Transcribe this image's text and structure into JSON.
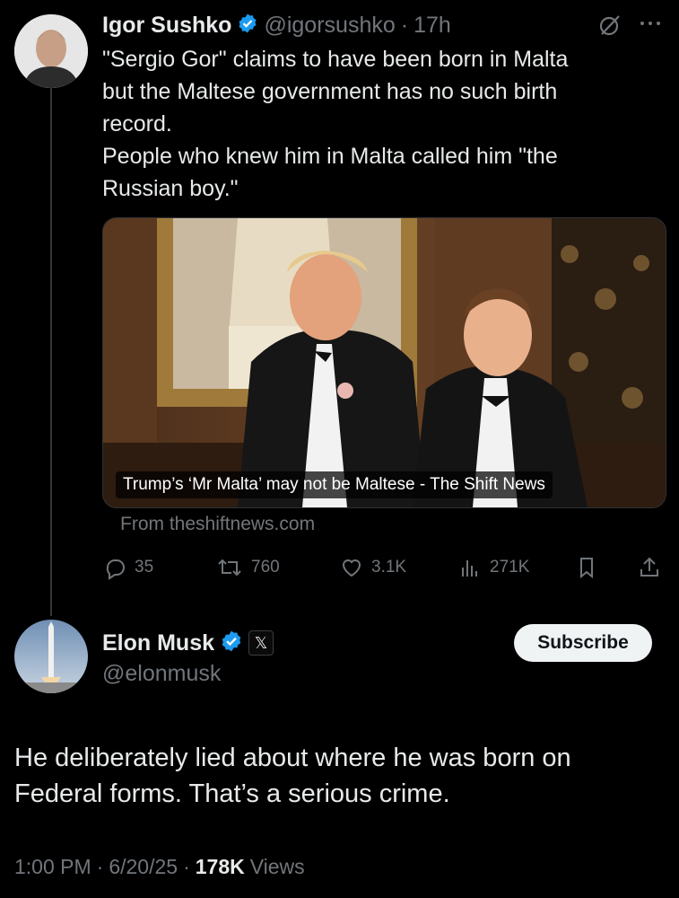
{
  "original": {
    "name": "Igor Sushko",
    "handle": "@igorsushko",
    "separator": "·",
    "time": "17h",
    "text_lines": [
      "\"Sergio Gor\" claims to have been born in Malta",
      "but the Maltese government has no such birth",
      "record.",
      "People who knew him in Malta called him \"the",
      "Russian boy.\""
    ],
    "card": {
      "caption": "Trump’s ‘Mr Malta’ may not be Maltese - The Shift News",
      "source": "From theshiftnews.com"
    },
    "actions": {
      "replies": "35",
      "reposts": "760",
      "likes": "3.1K",
      "views": "271K"
    }
  },
  "reply": {
    "name": "Elon Musk",
    "handle": "@elonmusk",
    "subscribe_label": "Subscribe",
    "text_lines": [
      "He deliberately lied about where he was born on",
      "Federal forms. That’s a serious crime."
    ],
    "meta": {
      "time": "1:00 PM",
      "sep1": "·",
      "date": "6/20/25",
      "sep2": "·",
      "views_count": "178K",
      "views_label": "Views"
    }
  },
  "colors": {
    "background": "#000000",
    "text": "#e7e9ea",
    "muted": "#71767b",
    "verified": "#1d9bf0",
    "button_bg": "#eff3f4"
  },
  "icons": [
    "grok-icon",
    "more-icon",
    "reply-icon",
    "repost-icon",
    "like-icon",
    "views-icon",
    "bookmark-icon",
    "share-icon",
    "verified-icon",
    "x-logo-icon"
  ]
}
